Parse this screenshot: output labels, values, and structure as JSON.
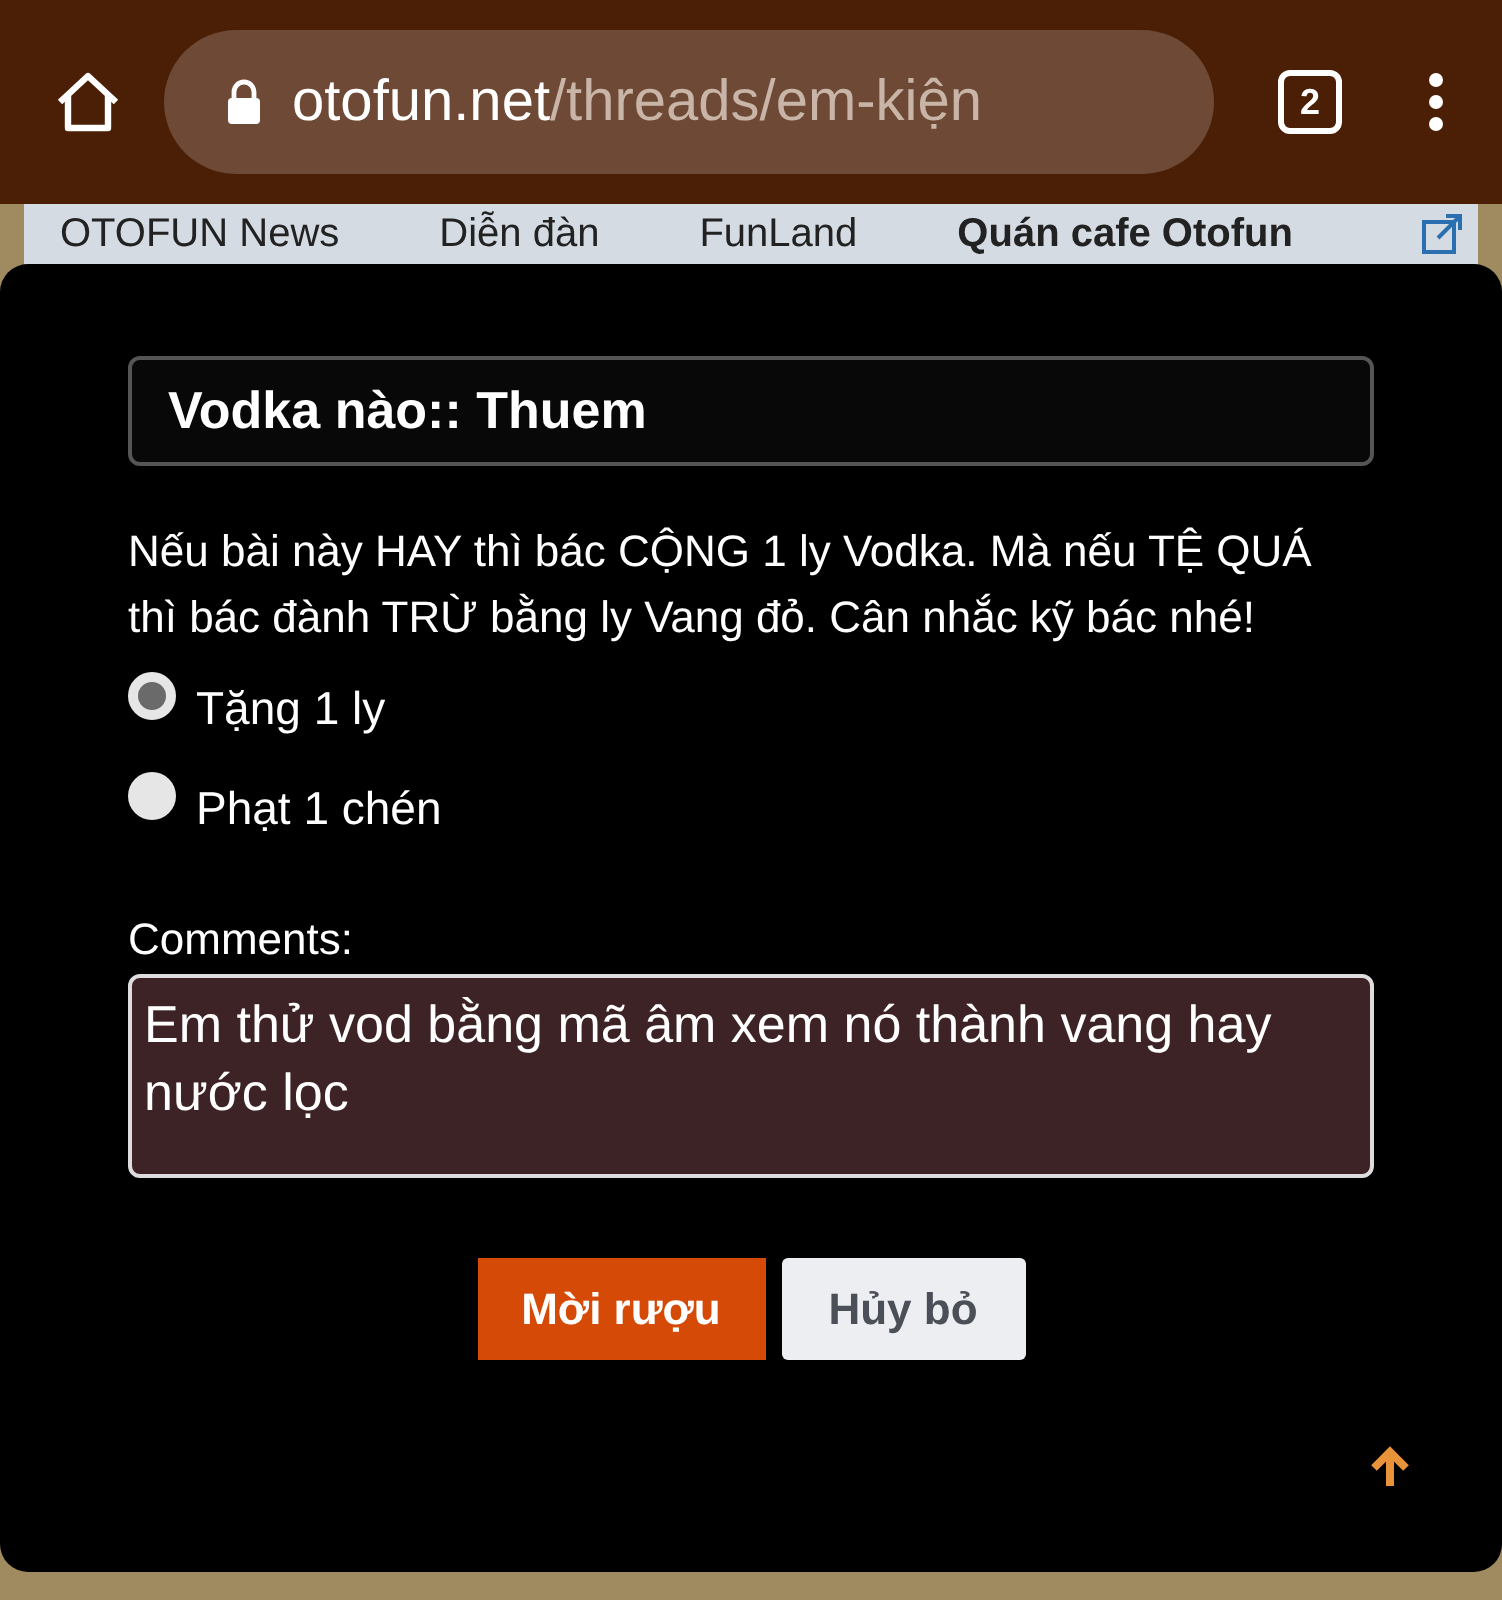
{
  "browser": {
    "url_host": "otofun.net",
    "url_path": "/threads/em-kiện",
    "tab_count": "2"
  },
  "breadcrumbs": [
    {
      "label": "OTOFUN News",
      "current": false
    },
    {
      "label": "Diễn đàn",
      "current": false
    },
    {
      "label": "FunLand",
      "current": false
    },
    {
      "label": "Quán cafe Otofun",
      "current": true
    }
  ],
  "dialog": {
    "title": "Vodka nào:: Thuem",
    "message": "Nếu bài này HAY thì bác CỘNG 1 ly Vodka. Mà nếu TỆ QUÁ thì bác đành TRỪ bằng ly Vang đỏ. Cân nhắc kỹ bác nhé!",
    "options": [
      {
        "label": "Tặng 1 ly",
        "selected": true
      },
      {
        "label": "Phạt 1 chén",
        "selected": false
      }
    ],
    "comments_label": "Comments:",
    "comments_value": "Em thử vod bằng mã âm xem nó thành vang hay nước lọc",
    "buttons": [
      {
        "label": "Mời rượu",
        "kind": "primary"
      },
      {
        "label": "Hủy bỏ",
        "kind": "secondary"
      }
    ]
  }
}
